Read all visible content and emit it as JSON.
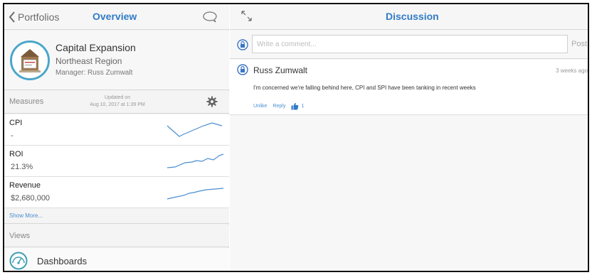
{
  "left_header": {
    "back_label": "Portfolios",
    "title": "Overview"
  },
  "project": {
    "title": "Capital Expansion",
    "region": "Northeast Region",
    "manager": "Manager: Russ Zumwalt"
  },
  "measures": {
    "label": "Measures",
    "updated_line1": "Updated on",
    "updated_line2": "Aug 10, 2017 at 1:39 PM",
    "items": [
      {
        "name": "CPI",
        "value": "-"
      },
      {
        "name": "ROI",
        "value": "21.3%"
      },
      {
        "name": "Revenue",
        "value": "$2,680,000"
      }
    ],
    "show_more": "Show More..."
  },
  "views": {
    "label": "Views",
    "items": [
      {
        "label": "Dashboards"
      }
    ]
  },
  "discussion": {
    "title": "Discussion",
    "placeholder": "Write a comment...",
    "post_label": "Post",
    "comments": [
      {
        "author": "Russ Zumwalt",
        "time": "3 weeks ago",
        "text": "I'm concerned we're falling behind here, CPI and SPI have been tanking in recent weeks",
        "unlike_label": "Unlike",
        "reply_label": "Reply",
        "like_count": "1"
      }
    ]
  },
  "colors": {
    "accent": "#2f7bc6",
    "link": "#4a8ed1",
    "avatar_ring": "#4aa6c9",
    "sparkline": "#4a8ed1"
  },
  "icons": {
    "back": "chevron-left-icon",
    "chat": "chat-bubble-icon",
    "settings": "gear-icon",
    "dashboards": "gauge-icon",
    "expand": "collapse-arrows-icon",
    "privacy": "lock-icon",
    "like": "thumbs-up-icon"
  }
}
